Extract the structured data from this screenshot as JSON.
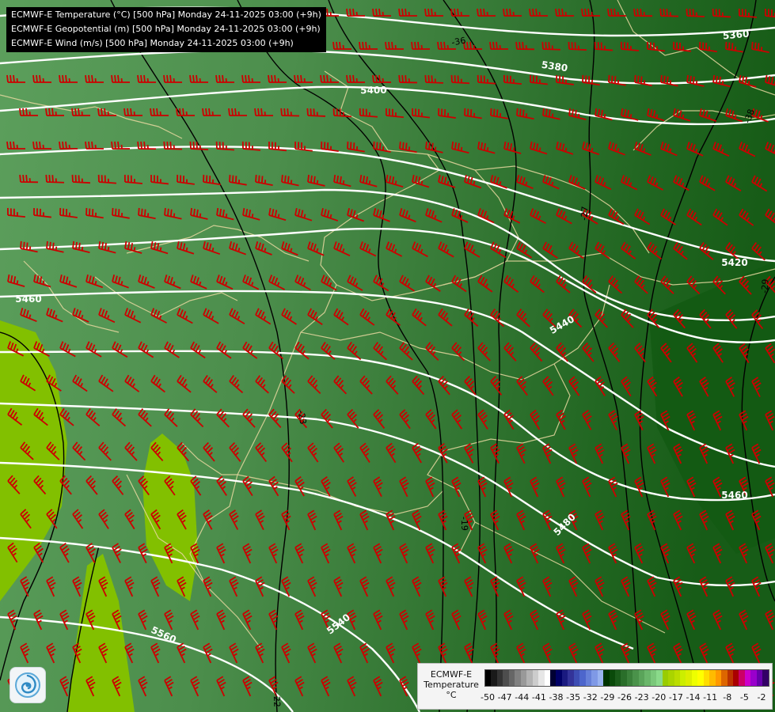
{
  "header": {
    "line1": "ECMWF-E Temperature (°C) [500 hPa] Monday 24-11-2025 03:00 (+9h)",
    "line2": "ECMWF-E Geopotential (m) [500 hPa] Monday 24-11-2025 03:00 (+9h)",
    "line3": "ECMWF-E Wind (m/s) [500 hPa] Monday 24-11-2025 03:00 (+9h)"
  },
  "legend": {
    "title_line1": "ECMWF-E",
    "title_line2": "Temperature",
    "title_line3": "°C",
    "ticks": [
      "-50",
      "-47",
      "-44",
      "-41",
      "-38",
      "-35",
      "-32",
      "-29",
      "-26",
      "-23",
      "-20",
      "-17",
      "-14",
      "-11",
      "-8",
      "-5",
      "-2"
    ],
    "colors": [
      "#000000",
      "#1a1a1a",
      "#333333",
      "#4d4d4d",
      "#666666",
      "#808080",
      "#999999",
      "#b3b3b3",
      "#cccccc",
      "#e6e6e6",
      "#ffffff",
      "#000033",
      "#000066",
      "#1a1a80",
      "#333399",
      "#3d4db3",
      "#4d66cc",
      "#6680d9",
      "#7f99e6",
      "#99b3f0",
      "#003300",
      "#0a4a0a",
      "#1a5c1a",
      "#2a6e2a",
      "#3a803a",
      "#4a924a",
      "#5aa45a",
      "#6ab66a",
      "#7ac87a",
      "#8ada8a",
      "#99cc00",
      "#aad400",
      "#bbdd00",
      "#ccee00",
      "#ddee00",
      "#eeff00",
      "#ffff00",
      "#ffdd00",
      "#ffbb00",
      "#ff9900",
      "#dd6600",
      "#bb3300",
      "#aa0000",
      "#cc0066",
      "#cc00cc",
      "#9900cc",
      "#6600aa",
      "#330066"
    ]
  },
  "isohypses": {
    "color": "#ffffff",
    "labels": [
      "5360",
      "5380",
      "5400",
      "5420",
      "5440",
      "5460",
      "5460",
      "5480",
      "5540",
      "5560"
    ]
  },
  "isotherms": {
    "color": "#000000",
    "labels": [
      "-36",
      "-38",
      "-27",
      "-29",
      "-23",
      "-19",
      "-22"
    ]
  },
  "wind_barbs": {
    "color": "#cc0000"
  },
  "borders": {
    "color": "#e8d8a0"
  },
  "temperature_fill": {
    "warm": "#80c000",
    "mid": "#5a9e5a",
    "cold": "#166016"
  },
  "logo": {
    "icon": "ecmwf-swirl-icon"
  }
}
